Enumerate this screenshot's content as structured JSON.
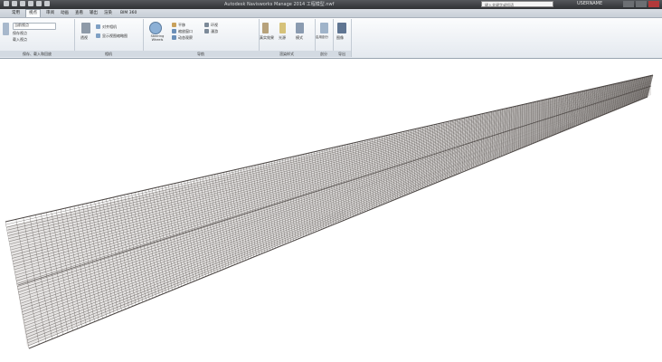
{
  "app": {
    "title": "Autodesk Navisworks Manage 2014  工程模型.nwf",
    "search_placeholder": "键入关键字或短语",
    "user": "USERNAME"
  },
  "tabs": [
    "常用",
    "视点",
    "审阅",
    "动画",
    "查看",
    "输出",
    "渲染",
    "BIM 360"
  ],
  "active_tab": 1,
  "ribbon": {
    "panel_save": {
      "label": "保存、载入和回放",
      "items": [
        "当前视点",
        "保存视点",
        "载入视点"
      ]
    },
    "panel_camera": {
      "label": "相机",
      "items": [
        "透视",
        "对齐相机",
        "显示视图缩略图"
      ]
    },
    "panel_nav": {
      "label": "导航",
      "wheels": "Steering Wheels",
      "items": [
        "平移",
        "缩放窗口",
        "动态观察",
        "环视",
        "漫游"
      ]
    },
    "panel_render": {
      "label": "渲染样式",
      "items": [
        "真实效果",
        "光源",
        "模式"
      ]
    },
    "panel_section": {
      "label": "剖分",
      "items": [
        "启用剖分"
      ]
    },
    "panel_export": {
      "label": "导出",
      "items": [
        "图像"
      ]
    }
  },
  "colors": {
    "titlebar": "#3a3d41",
    "ribbon_bg": "#eef1f5",
    "rebar": "#3b3532"
  }
}
